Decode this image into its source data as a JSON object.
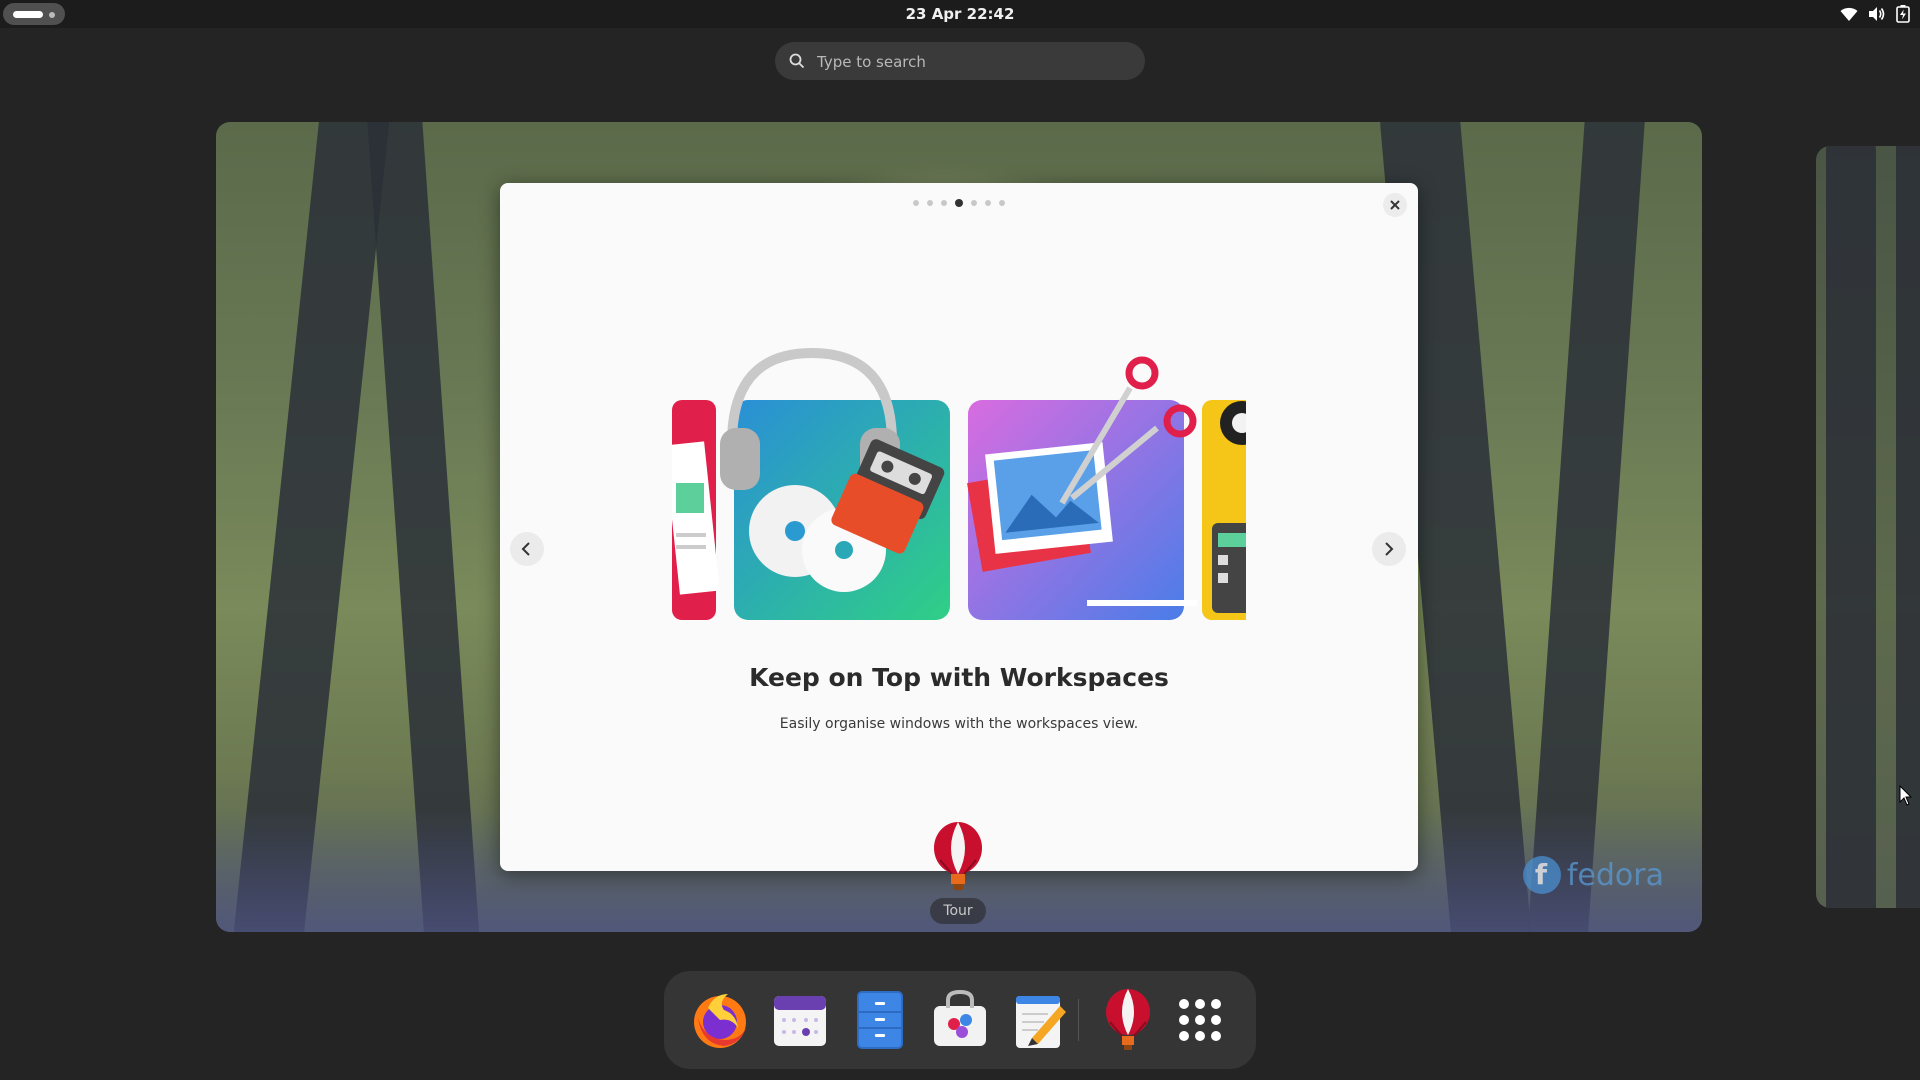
{
  "topbar": {
    "clock": "23 Apr  22:42",
    "activities_icon": "workspaces-indicator-icon",
    "tray_icons": [
      "wifi-icon",
      "volume-icon",
      "battery-icon"
    ]
  },
  "search": {
    "placeholder": "Type to search",
    "value": ""
  },
  "tour": {
    "page_dots": 7,
    "active_dot": 4,
    "title": "Keep on Top with Workspaces",
    "subtitle": "Easily organise windows with the workspaces view.",
    "window_label": "Tour"
  },
  "wallpaper": {
    "brand": "fedora"
  },
  "dash": {
    "items": [
      {
        "name": "firefox",
        "icon": "firefox-icon"
      },
      {
        "name": "calendar",
        "icon": "calendar-icon"
      },
      {
        "name": "files",
        "icon": "files-icon"
      },
      {
        "name": "software",
        "icon": "software-store-icon"
      },
      {
        "name": "text-editor",
        "icon": "text-editor-icon"
      },
      {
        "name": "tour",
        "icon": "hot-air-balloon-icon"
      },
      {
        "name": "show-apps",
        "icon": "app-grid-icon"
      }
    ]
  },
  "colors": {
    "panel": "#1c1c1c",
    "background": "#242424",
    "dash": "#353535",
    "accent_balloon": "#c8102e",
    "fedora_blue": "#5a9ad4"
  }
}
